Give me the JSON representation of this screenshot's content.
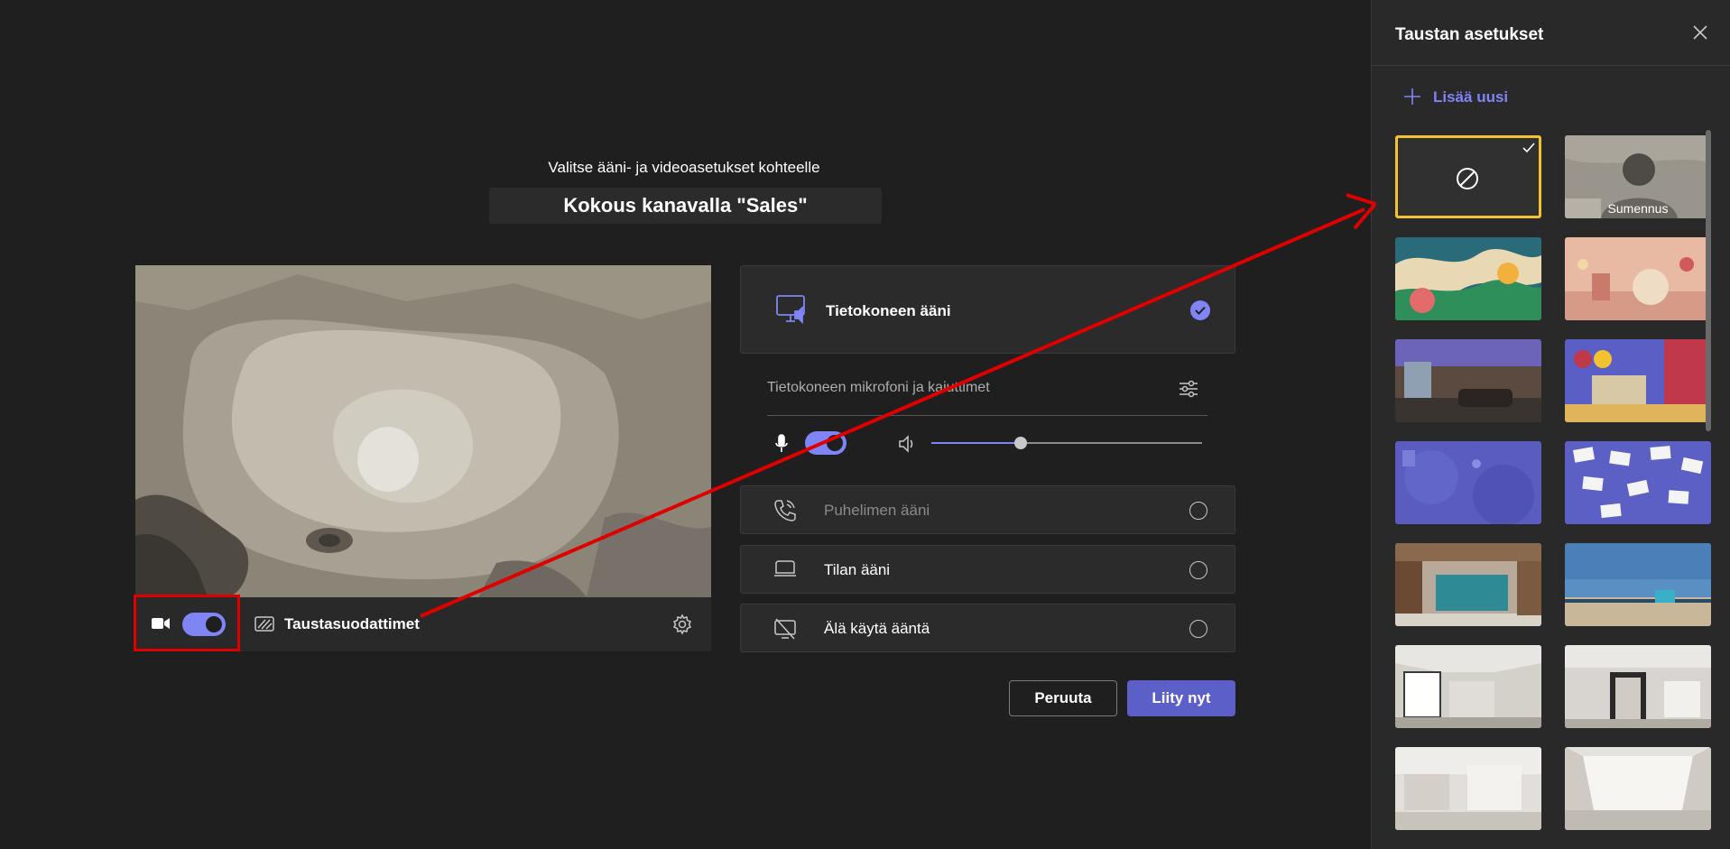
{
  "prejoin": {
    "subtitle": "Valitse ääni- ja videoasetukset kohteelle",
    "meeting_title": "Kokous kanavalla \"Sales\""
  },
  "video": {
    "camera_on": true,
    "background_filters_label": "Taustasuodattimet"
  },
  "audio": {
    "computer_audio_label": "Tietokoneen ääni",
    "devices_label": "Tietokoneen mikrofoni ja kaiuttimet",
    "mic_on": true,
    "volume_fraction": 0.33,
    "phone_audio_label": "Puhelimen ääni",
    "room_audio_label": "Tilan ääni",
    "no_audio_label": "Älä käytä ääntä"
  },
  "buttons": {
    "cancel": "Peruuta",
    "join": "Liity nyt"
  },
  "panel": {
    "title": "Taustan asetukset",
    "add_new": "Lisää uusi",
    "blur_label": "Sumennus"
  },
  "colors": {
    "accent": "#7f85f5",
    "join": "#5b5fc7",
    "selected": "#f2c230",
    "annotation": "#e00000"
  }
}
